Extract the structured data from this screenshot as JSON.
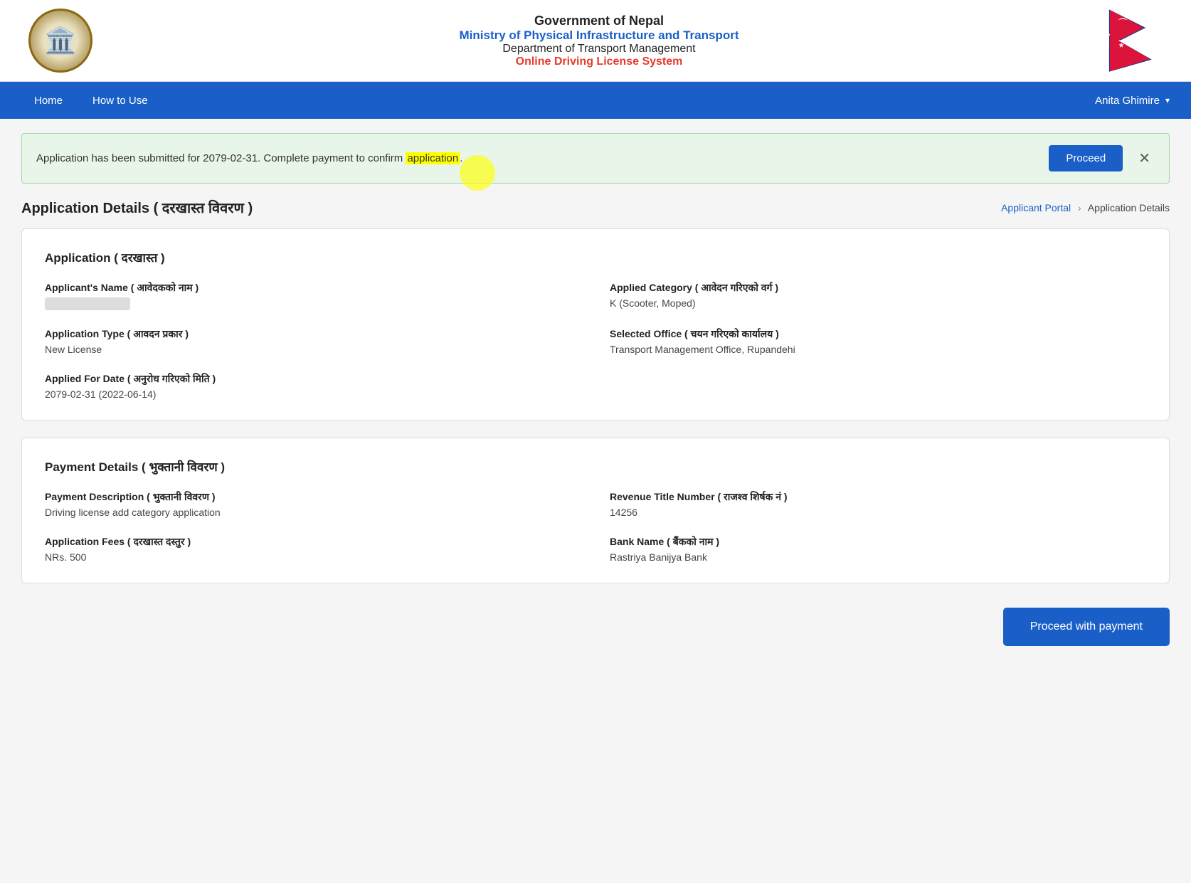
{
  "header": {
    "title_main": "Government of Nepal",
    "title_ministry": "Ministry of Physical Infrastructure and Transport",
    "title_dept": "Department of Transport Management",
    "title_system": "Online Driving License System"
  },
  "navbar": {
    "items": [
      {
        "label": "Home",
        "id": "home"
      },
      {
        "label": "How to Use",
        "id": "how-to-use"
      }
    ],
    "user": "Anita Ghimire"
  },
  "alert": {
    "message_before": "Application has been submitted for 2079-02-31. Complete payment to confirm ",
    "highlight": "application",
    "message_after": ".",
    "proceed_label": "Proceed"
  },
  "page": {
    "title": "Application Details ( दरखास्त विवरण )",
    "breadcrumb_link": "Applicant Portal",
    "breadcrumb_current": "Application Details"
  },
  "application_section": {
    "title": "Application ( दरखास्त )",
    "fields": [
      {
        "label": "Applicant's Name ( आवेदकको नाम )",
        "value": "",
        "blurred": true
      },
      {
        "label": "Applied Category ( आवेदन गरिएको वर्ग )",
        "value": "K (Scooter, Moped)",
        "blurred": false
      },
      {
        "label": "Application Type ( आवदन प्रकार )",
        "value": "New License",
        "blurred": false
      },
      {
        "label": "Selected Office ( चयन गरिएको कार्यालय )",
        "value": "Transport Management Office, Rupandehi",
        "blurred": false
      },
      {
        "label": "Applied For Date ( अनुरोध गरिएको मिति )",
        "value": "2079-02-31 (2022-06-14)",
        "blurred": false
      }
    ]
  },
  "payment_section": {
    "title": "Payment Details ( भुक्तानी विवरण )",
    "fields": [
      {
        "label": "Payment Description ( भुक्तानी विवरण )",
        "value": "Driving license add category application"
      },
      {
        "label": "Revenue Title Number ( राजश्व शिर्षक नं )",
        "value": "14256"
      },
      {
        "label": "Application Fees ( दरखास्त दस्तुर )",
        "value": "NRs. 500"
      },
      {
        "label": "Bank Name ( बैंकको नाम )",
        "value": "Rastriya Banijya Bank"
      }
    ]
  },
  "bottom": {
    "proceed_payment_label": "Proceed with payment"
  }
}
